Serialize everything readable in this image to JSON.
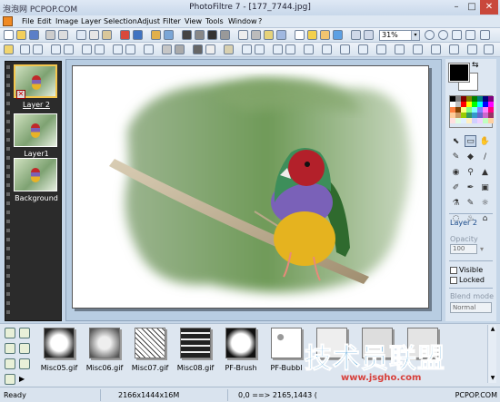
{
  "window": {
    "title": "PhotoFiltre 7 - [177_7744.jpg]",
    "watermark_top": "泡泡网 PCPOP.COM",
    "minimize_glyph": "–",
    "maximize_glyph": "□",
    "close_glyph": "✕"
  },
  "menu": [
    "File",
    "Edit",
    "Image",
    "Layer",
    "Selection",
    "Adjust",
    "Filter",
    "View",
    "Tools",
    "Window",
    "?"
  ],
  "toolbar": {
    "zoom": "31%",
    "dropdown_glyph": "▾"
  },
  "layers": [
    {
      "name": "Layer 2",
      "selected": true
    },
    {
      "name": "Layer1",
      "selected": false
    },
    {
      "name": "Background",
      "selected": false
    }
  ],
  "layer_delete_glyph": "✕",
  "right_panel": {
    "swap_glyph": "⇆",
    "layer_name": "Layer 2",
    "opacity_label": "Opacity",
    "opacity_value": "100",
    "visible_label": "Visible",
    "locked_label": "Locked",
    "blend_label": "Blend mode",
    "blend_value": "Normal"
  },
  "tools": [
    "⬉",
    "▭",
    "✋",
    "✎",
    "◆",
    "/",
    "◉",
    "⚲",
    "▲",
    "✐",
    "✒",
    "▣",
    "⚗",
    "✎",
    "☼",
    "◌",
    "♨",
    "⌂"
  ],
  "palette": [
    "#000000",
    "#808080",
    "#800000",
    "#808000",
    "#008000",
    "#008080",
    "#000080",
    "#800080",
    "#ffffff",
    "#c0c0c0",
    "#ff0000",
    "#ffff00",
    "#00ff00",
    "#00ffff",
    "#0000ff",
    "#ff00ff",
    "#ff8040",
    "#804000",
    "#ffff80",
    "#80ff80",
    "#80ffff",
    "#8080ff",
    "#ff80ff",
    "#ff0080",
    "#ffcc99",
    "#cc9966",
    "#99cc00",
    "#339966",
    "#3399cc",
    "#6666cc",
    "#cc66cc",
    "#993366",
    "#ffe0e0",
    "#e0ffe0",
    "#e0f0ff",
    "#fff0c0",
    "#d0d0ff",
    "#f0d0ff",
    "#c0ffc0",
    "#ffd0a0"
  ],
  "filters": [
    "Misc05.gif",
    "Misc06.gif",
    "Misc07.gif",
    "Misc08.gif",
    "PF-Brush",
    "PF-Bubbl",
    "",
    "",
    "",
    ""
  ],
  "filter_nav": {
    "arrow": "▶",
    "up": "▲",
    "down": "▼"
  },
  "watermark": {
    "big": "技术员联盟",
    "small": "www.jsgho.com"
  },
  "status": {
    "state": "Ready",
    "size": "2166x1444x16M",
    "coords": "0,0 ==> 2165,1443 (",
    "site": "PCPOP.COM"
  }
}
